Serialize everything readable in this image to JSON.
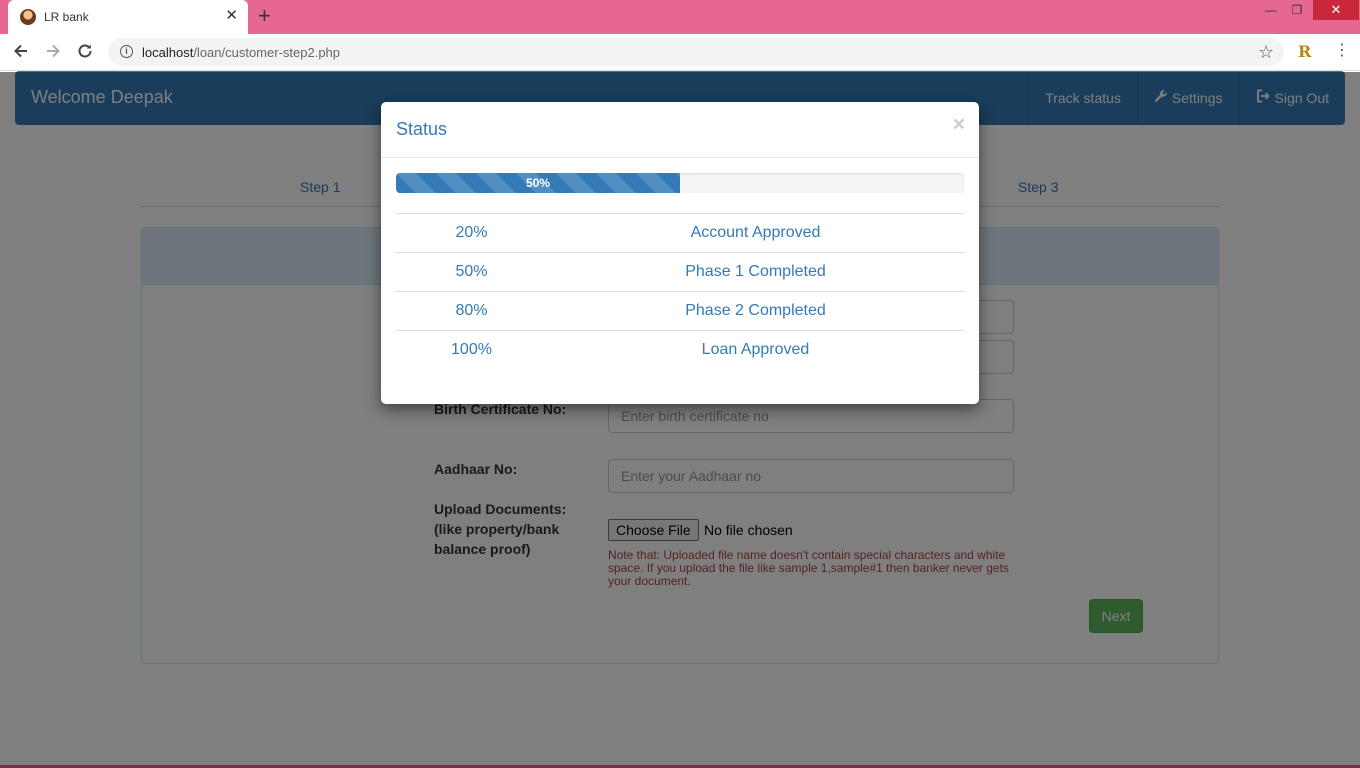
{
  "browser": {
    "tab_title": "LR bank",
    "tab_close": "✕",
    "new_tab": "+",
    "url_host": "localhost",
    "url_path": "/loan/customer-step2.php",
    "window": {
      "minimize": "—",
      "restore": "❐",
      "close": "✕"
    },
    "extension_letter": "R"
  },
  "navbar": {
    "brand": "Welcome Deepak",
    "links": [
      {
        "label": "Track status"
      },
      {
        "label": "Settings",
        "icon": "wrench-icon"
      },
      {
        "label": "Sign Out",
        "icon": "sign-out-icon"
      }
    ]
  },
  "steps": {
    "step1": "Step 1",
    "step3": "Step 3"
  },
  "form": {
    "birth_label": "Birth Certificate No:",
    "birth_placeholder": "Enter birth certificate no",
    "aadhaar_label": "Aadhaar No:",
    "aadhaar_placeholder": "Enter your Aadhaar no",
    "upload_label_1": "Upload Documents:",
    "upload_label_2": "(like property/bank",
    "upload_label_3": "balance proof)",
    "file_button": "Choose File",
    "file_status": "No file chosen",
    "note": "Note that: Uploaded file name doesn't contain special characters and white space. If you upload the file like sample 1,sample#1 then banker never gets your document.",
    "next_button": "Next"
  },
  "modal": {
    "title": "Status",
    "close": "×",
    "progress_label": "50%",
    "progress_fraction": 0.5,
    "rows": [
      {
        "pct": "20%",
        "status": "Account Approved"
      },
      {
        "pct": "50%",
        "status": "Phase 1 Completed"
      },
      {
        "pct": "80%",
        "status": "Phase 2 Completed"
      },
      {
        "pct": "100%",
        "status": "Loan Approved"
      }
    ]
  },
  "colors": {
    "tabbar": "#e6678f",
    "primary": "#337ab7",
    "success": "#5cb85c",
    "danger_text": "#a94442"
  }
}
